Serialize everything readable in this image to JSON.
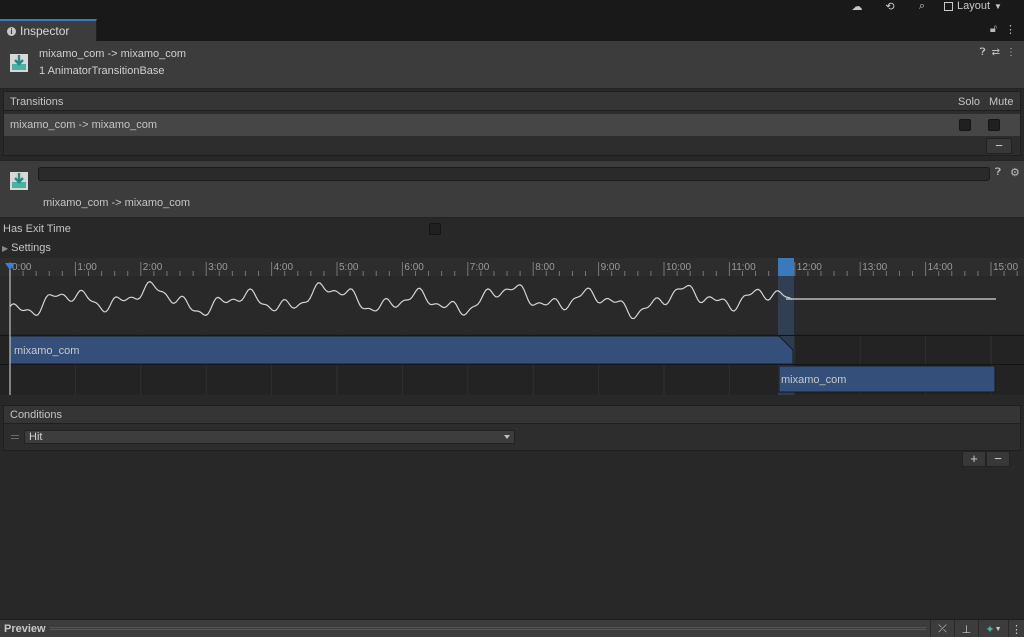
{
  "toolbar": {
    "layout_label": "Layout",
    "icons": [
      "account-icon",
      "history-icon",
      "search-icon",
      "layout-icon"
    ]
  },
  "tab": {
    "label": "Inspector"
  },
  "header": {
    "title": "mixamo_com -> mixamo_com",
    "subtitle": "1 AnimatorTransitionBase"
  },
  "transitions": {
    "title": "Transitions",
    "solo_label": "Solo",
    "mute_label": "Mute",
    "items": [
      {
        "name": "mixamo_com -> mixamo_com"
      }
    ],
    "remove_label": "−"
  },
  "transition": {
    "name_value": "",
    "label": "mixamo_com -> mixamo_com"
  },
  "settings": {
    "has_exit_time_label": "Has Exit Time",
    "settings_label": "Settings"
  },
  "timeline": {
    "ticks": [
      "0:00",
      "1:00",
      "2:00",
      "3:00",
      "4:00",
      "5:00",
      "6:00",
      "7:00",
      "8:00",
      "9:00",
      "10:00",
      "11:00",
      "12:00",
      "13:00",
      "14:00",
      "15:00"
    ],
    "source_clip": "mixamo_com",
    "dest_clip": "mixamo_com"
  },
  "conditions": {
    "title": "Conditions",
    "items": [
      {
        "parameter": "Hit"
      }
    ],
    "add_label": "+",
    "remove_label": "−"
  },
  "preview": {
    "label": "Preview"
  },
  "colors": {
    "accent": "#3a79bb",
    "clip_fill": "#34507a",
    "panel": "#3c3c3c",
    "background": "#282828"
  }
}
